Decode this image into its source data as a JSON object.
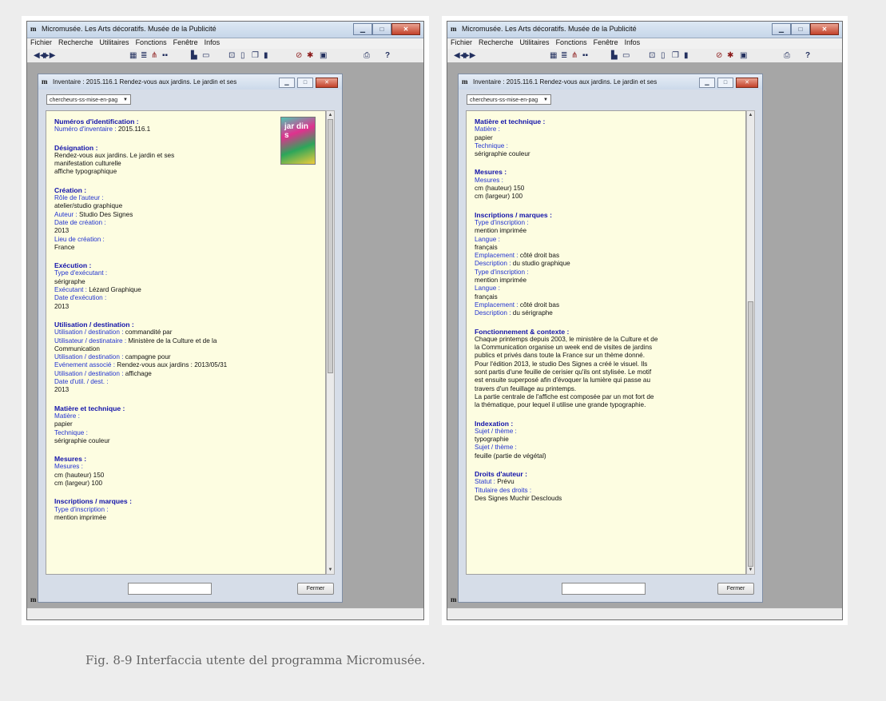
{
  "window_title": "Micromusée. Les Arts décoratifs. Musée de la Publicité",
  "menu": [
    "Fichier",
    "Recherche",
    "Utilitaires",
    "Fonctions",
    "Fenêtre",
    "Infos"
  ],
  "record_title": "Inventaire : 2015.116.1 Rendez-vous aux jardins. Le jardin et ses",
  "profile_select": "chercheurs-ss-mise-en-pag",
  "close_button": "Fermer",
  "poster_text": "jar din s",
  "left_sections": [
    {
      "heading": "Numéros d'identification :",
      "lines": [
        {
          "label": "Numéro d'inventaire :",
          "value": "2015.116.1"
        }
      ]
    },
    {
      "heading": "Désignation :",
      "lines": [
        {
          "value": "Rendez-vous aux jardins. Le jardin et ses"
        },
        {
          "value": "manifestation culturelle"
        },
        {
          "value": "affiche typographique"
        }
      ]
    },
    {
      "heading": "Création :",
      "lines": [
        {
          "label": "Rôle de l'auteur :"
        },
        {
          "value": "atelier/studio graphique"
        },
        {
          "label": "Auteur :",
          "value": "Studio Des Signes"
        },
        {
          "label": "Date de création :"
        },
        {
          "value": "2013"
        },
        {
          "label": "Lieu de création :"
        },
        {
          "value": "France"
        }
      ]
    },
    {
      "heading": "Exécution :",
      "lines": [
        {
          "label": "Type d'exécutant :"
        },
        {
          "value": "sérigraphe"
        },
        {
          "label": "Exécutant :",
          "value": "Lézard Graphique"
        },
        {
          "label": "Date d'exécution :"
        },
        {
          "value": "2013"
        }
      ]
    },
    {
      "heading": "Utilisation / destination :",
      "lines": [
        {
          "label": "Utilisation / destination :",
          "value": "commandité par"
        },
        {
          "label": "Utilisateur / destinataire :",
          "value": "Ministère de la Culture et de la"
        },
        {
          "value": "Communication"
        },
        {
          "label": "Utilisation / destination :",
          "value": "campagne pour"
        },
        {
          "label": "Evénement associé :",
          "value": "Rendez-vous aux jardins : 2013/05/31"
        },
        {
          "label": "Utilisation / destination :",
          "value": "affichage"
        },
        {
          "label": "Date d'util. / dest. :"
        },
        {
          "value": "2013"
        }
      ]
    },
    {
      "heading": "Matière et technique :",
      "lines": [
        {
          "label": "Matière :"
        },
        {
          "value": "papier"
        },
        {
          "label": "Technique :"
        },
        {
          "value": "sérigraphie couleur"
        }
      ]
    },
    {
      "heading": "Mesures :",
      "lines": [
        {
          "label": "Mesures :"
        },
        {
          "value": "cm (hauteur)  150"
        },
        {
          "value": "cm (largeur)  100"
        }
      ]
    },
    {
      "heading": "Inscriptions / marques :",
      "lines": [
        {
          "label": "Type d'inscription :"
        },
        {
          "value": "mention imprimée"
        }
      ]
    }
  ],
  "right_sections": [
    {
      "heading": "Matière et technique :",
      "lines": [
        {
          "label": "Matière :"
        },
        {
          "value": "papier"
        },
        {
          "label": "Technique :"
        },
        {
          "value": "sérigraphie couleur"
        }
      ]
    },
    {
      "heading": "Mesures :",
      "lines": [
        {
          "label": "Mesures :"
        },
        {
          "value": "cm (hauteur)  150"
        },
        {
          "value": "cm (largeur)  100"
        }
      ]
    },
    {
      "heading": "Inscriptions / marques :",
      "lines": [
        {
          "label": "Type d'inscription :"
        },
        {
          "value": "mention imprimée"
        },
        {
          "label": "Langue :"
        },
        {
          "value": "français"
        },
        {
          "label": "Emplacement :",
          "value": "côté droit bas"
        },
        {
          "label": "Description :",
          "value": "du studio graphique"
        },
        {
          "label": "Type d'inscription :"
        },
        {
          "value": "mention imprimée"
        },
        {
          "label": "Langue :"
        },
        {
          "value": "français"
        },
        {
          "label": "Emplacement :",
          "value": "côté droit bas"
        },
        {
          "label": "Description :",
          "value": "du sérigraphe"
        }
      ]
    },
    {
      "heading": "Fonctionnement & contexte :",
      "lines": [
        {
          "value": "Chaque printemps depuis 2003, le ministère de la Culture et de"
        },
        {
          "value": "la Communication organise un week end de visites de jardins"
        },
        {
          "value": "publics et privés dans toute la France sur un thème donné."
        },
        {
          "value": "Pour l'édition 2013, le studio Des Signes a créé le visuel. Ils"
        },
        {
          "value": "sont partis d'une feuille de cerisier qu'ils ont stylisée. Le motif"
        },
        {
          "value": "est ensuite superposé afin d'évoquer la lumière qui passe au"
        },
        {
          "value": "travers d'un feuillage au printemps."
        },
        {
          "value": "La partie centrale de l'affiche est composée par un mot fort de"
        },
        {
          "value": "la thématique, pour lequel il utilise une grande typographie."
        }
      ]
    },
    {
      "heading": "Indexation :",
      "lines": [
        {
          "label": "Sujet / thème :"
        },
        {
          "value": "typographie"
        },
        {
          "label": "Sujet / thème :"
        },
        {
          "value": "feuille (partie de végétal)"
        }
      ]
    },
    {
      "heading": "Droits d'auteur :",
      "lines": [
        {
          "label": "Statut :",
          "value": "Prévu"
        },
        {
          "label": "Titulaire des droits :"
        },
        {
          "value": "Des Signes Muchir Desclouds"
        }
      ]
    }
  ],
  "caption": "Fig. 8-9 Interfaccia utente del programma Micromusée."
}
